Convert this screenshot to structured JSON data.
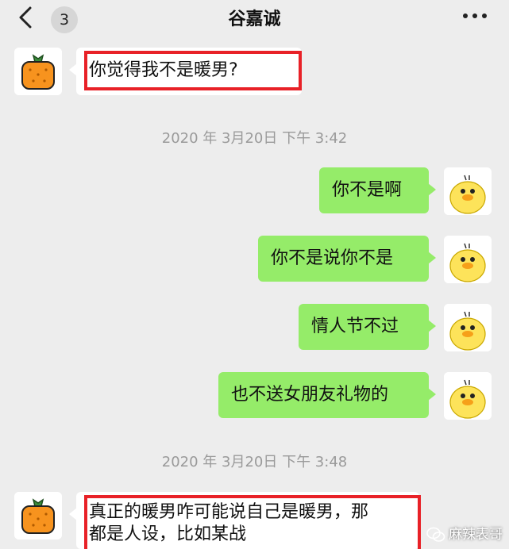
{
  "header": {
    "title": "谷嘉诚",
    "unread_count": "3"
  },
  "messages": [
    {
      "side": "left",
      "text": "你觉得我不是暖男?"
    },
    {
      "side": "right",
      "text": "你不是啊"
    },
    {
      "side": "right",
      "text": "你不是说你不是"
    },
    {
      "side": "right",
      "text": "情人节不过"
    },
    {
      "side": "right",
      "text": "也不送女朋友礼物的"
    },
    {
      "side": "left",
      "text_line1": "真正的暖男咋可能说自己是暖男，那",
      "text_line2": "都是人设，比如某战"
    }
  ],
  "timestamps": [
    "2020 年 3月20日 下午 3:42",
    "2020 年 3月20日 下午 3:48"
  ],
  "watermark": "麻辣表哥",
  "colors": {
    "bubble_green": "#95ec69",
    "highlight_red": "#e82127",
    "background": "#ededed"
  },
  "icons": [
    "back-chevron-icon",
    "more-dots-icon",
    "persimmon-avatar-icon",
    "duck-avatar-icon",
    "wechat-watermark-icon"
  ]
}
